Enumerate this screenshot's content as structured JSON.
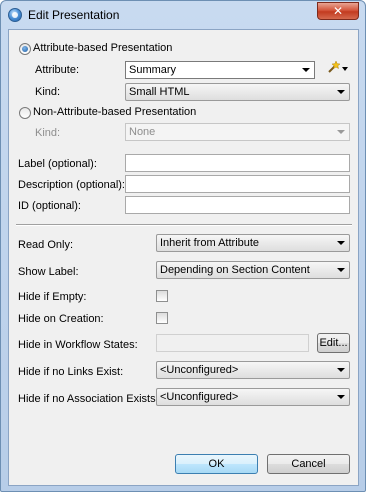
{
  "window": {
    "title": "Edit Presentation",
    "icon": "app-globe-icon",
    "close_icon": "close-icon"
  },
  "attr_section": {
    "radio_label": "Attribute-based Presentation",
    "attribute_label": "Attribute:",
    "attribute_value": "Summary",
    "kind_label": "Kind:",
    "kind_value": "Small HTML",
    "wand_icon": "magic-wand-icon"
  },
  "nonattr_section": {
    "radio_label": "Non-Attribute-based Presentation",
    "kind_label": "Kind:",
    "kind_value": "None"
  },
  "fields": {
    "label_label": "Label (optional):",
    "description_label": "Description (optional):",
    "id_label": "ID (optional):"
  },
  "options": {
    "read_only_label": "Read Only:",
    "read_only_value": "Inherit from Attribute",
    "show_label_label": "Show Label:",
    "show_label_value": "Depending on Section Content",
    "hide_if_empty_label": "Hide if Empty:",
    "hide_on_creation_label": "Hide on Creation:",
    "hide_states_label": "Hide in Workflow States:",
    "edit_button": "Edit...",
    "hide_no_links_label": "Hide if no Links Exist:",
    "hide_no_links_value": "<Unconfigured>",
    "hide_no_assoc_label": "Hide if no Association Exists:",
    "hide_no_assoc_value": "<Unconfigured>"
  },
  "buttons": {
    "ok": "OK",
    "cancel": "Cancel"
  },
  "colors": {
    "title_bar": "#b7cde8",
    "dialog_bg": "#f0f0f0",
    "close_button": "#c23b20",
    "ok_border": "#3c7fb1"
  }
}
